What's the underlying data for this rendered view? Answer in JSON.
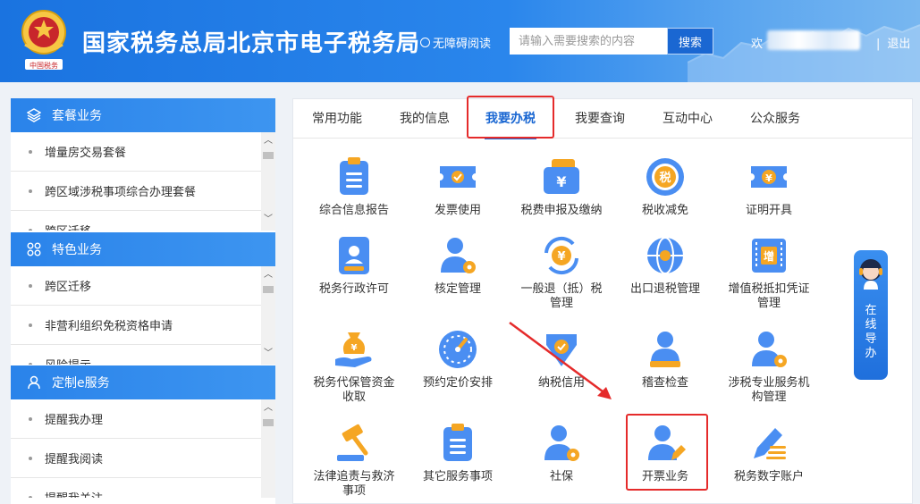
{
  "header": {
    "site_title": "国家税务总局北京市电子税务局",
    "accessibility": "无障碍阅读",
    "search_placeholder": "请输入需要搜索的内容",
    "search_button": "搜索",
    "welcome": "欢",
    "logout": "退出",
    "emblem_text": "中国税务"
  },
  "sidebar": {
    "sections": [
      {
        "title": "套餐业务",
        "icon": "layers-icon",
        "items": [
          "增量房交易套餐",
          "跨区域涉税事项综合办理套餐",
          "跨区迁移"
        ]
      },
      {
        "title": "特色业务",
        "icon": "apps-icon",
        "items": [
          "跨区迁移",
          "非营利组织免税资格申请",
          "风险提示"
        ]
      },
      {
        "title": "定制e服务",
        "icon": "user-icon",
        "items": [
          "提醒我办理",
          "提醒我阅读",
          "提醒我关注"
        ]
      }
    ]
  },
  "tabs": [
    {
      "label": "常用功能",
      "active": false
    },
    {
      "label": "我的信息",
      "active": false
    },
    {
      "label": "我要办税",
      "active": true
    },
    {
      "label": "我要查询",
      "active": false
    },
    {
      "label": "互动中心",
      "active": false
    },
    {
      "label": "公众服务",
      "active": false
    }
  ],
  "services": [
    {
      "id": "comprehensive-report",
      "label": "综合信息报告",
      "icon": "clipboard-icon"
    },
    {
      "id": "invoice-use",
      "label": "发票使用",
      "icon": "invoice-ticket-icon"
    },
    {
      "id": "tax-declaration",
      "label": "税费申报及缴纳",
      "icon": "wallet-yuan-icon"
    },
    {
      "id": "tax-reduction",
      "label": "税收减免",
      "icon": "tax-medal-icon"
    },
    {
      "id": "certificate",
      "label": "证明开具",
      "icon": "yuan-ticket-icon"
    },
    {
      "id": "admin-permit",
      "label": "税务行政许可",
      "icon": "id-badge-icon"
    },
    {
      "id": "assessment",
      "label": "核定管理",
      "icon": "user-gear-icon"
    },
    {
      "id": "refund",
      "label": "一般退（抵）税管理",
      "icon": "yuan-refresh-icon"
    },
    {
      "id": "export-refund",
      "label": "出口退税管理",
      "icon": "globe-icon"
    },
    {
      "id": "vat-deduction",
      "label": "增值税抵扣凭证管理",
      "icon": "vat-ticket-icon"
    },
    {
      "id": "deposit",
      "label": "税务代保管资金收取",
      "icon": "money-hand-icon"
    },
    {
      "id": "pricing",
      "label": "预约定价安排",
      "icon": "gauge-icon"
    },
    {
      "id": "credit",
      "label": "纳税信用",
      "icon": "shield-check-icon"
    },
    {
      "id": "inspection",
      "label": "稽查检查",
      "icon": "user-desk-icon"
    },
    {
      "id": "agency",
      "label": "涉税专业服务机构管理",
      "icon": "user-gear-icon"
    },
    {
      "id": "legal",
      "label": "法律追责与救济事项",
      "icon": "gavel-icon"
    },
    {
      "id": "other",
      "label": "其它服务事项",
      "icon": "clipboard-icon"
    },
    {
      "id": "social",
      "label": "社保",
      "icon": "user-gear-icon"
    },
    {
      "id": "invoicing",
      "label": "开票业务",
      "icon": "user-pen-icon"
    },
    {
      "id": "digital-account",
      "label": "税务数字账户",
      "icon": "pen-lines-icon"
    }
  ],
  "float_widget": {
    "chars": [
      "在",
      "线",
      "导",
      "办"
    ],
    "icon": "agent-avatar-icon"
  },
  "colors": {
    "brand": "#1a73e0",
    "accent": "#4a8ef2",
    "highlight": "#e52b2b"
  }
}
